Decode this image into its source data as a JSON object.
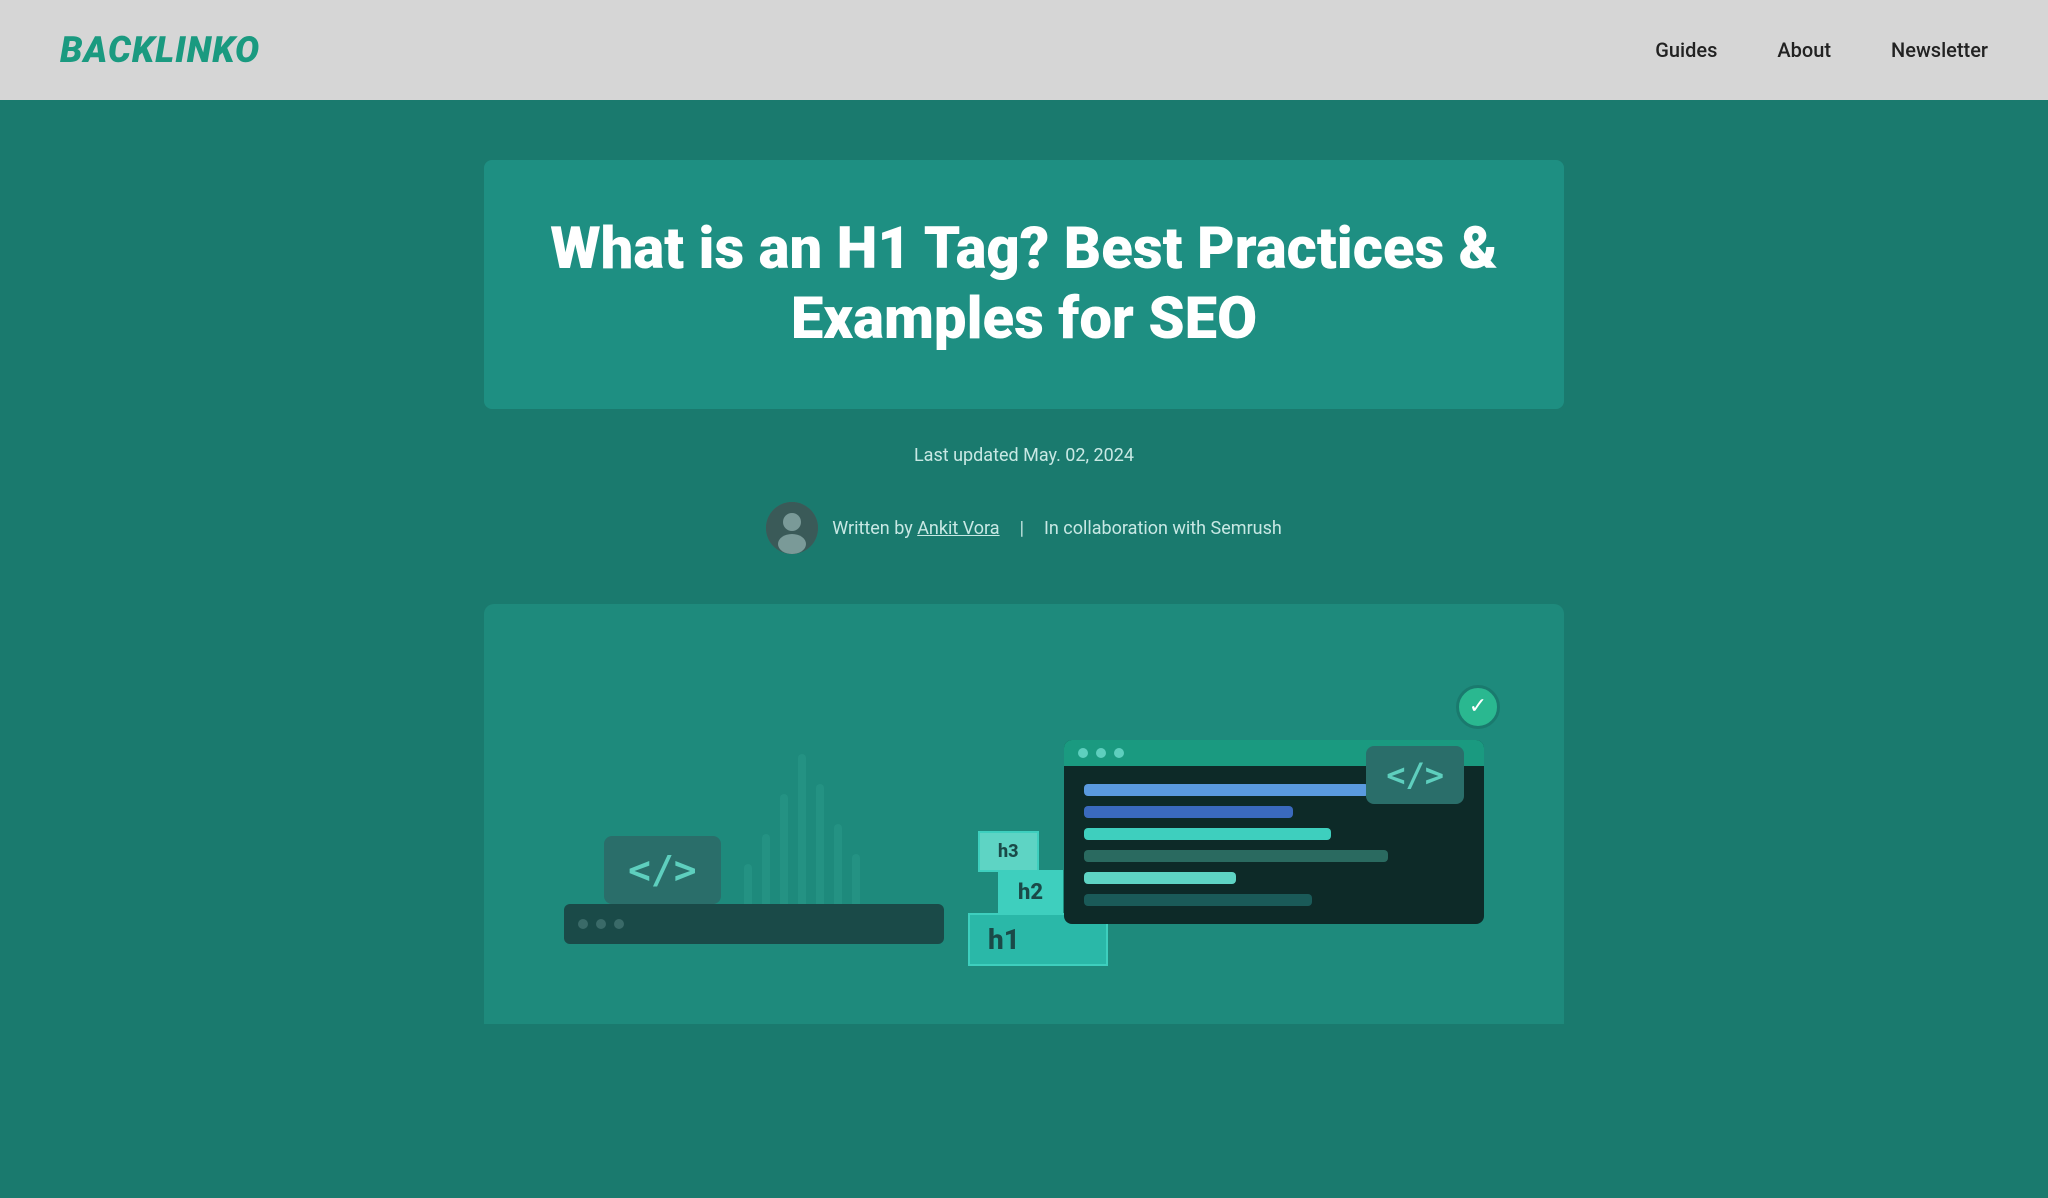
{
  "header": {
    "logo": "BACKLINKO",
    "nav": {
      "guides": "Guides",
      "about": "About",
      "newsletter": "Newsletter"
    }
  },
  "hero": {
    "title": "What is an H1 Tag? Best Practices & Examples for SEO",
    "last_updated_label": "Last updated May. 02, 2024",
    "author_prefix": "Written by ",
    "author_name": "Ankit Vora",
    "collaboration_text": "In collaboration with Semrush"
  },
  "illustration": {
    "bracket_code": "</>",
    "h3_label": "h3",
    "h2_label": "h2",
    "h1_label": "h1"
  }
}
